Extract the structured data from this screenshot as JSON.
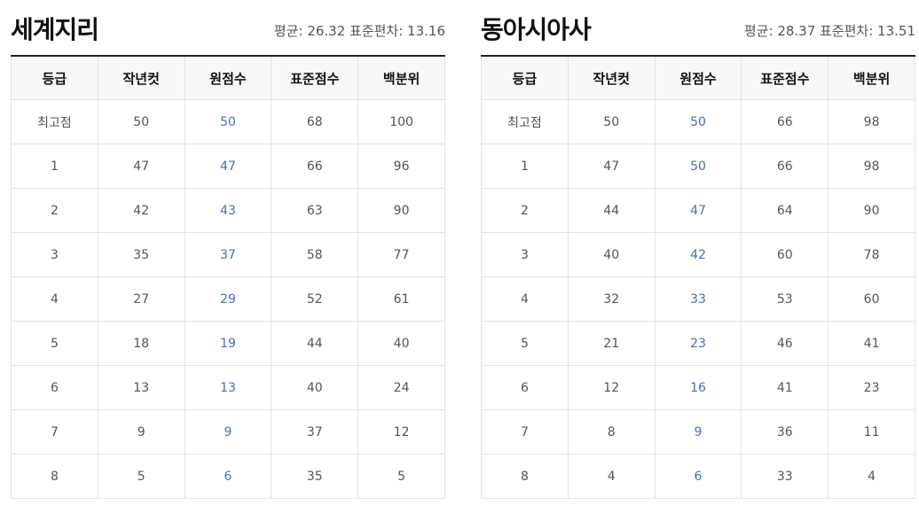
{
  "headers": [
    "등급",
    "작년컷",
    "원점수",
    "표준점수",
    "백분위"
  ],
  "tables": [
    {
      "title": "세계지리",
      "stats": "평균: 26.32 표준편차: 13.16",
      "rows": [
        [
          "최고점",
          "50",
          "50",
          "68",
          "100"
        ],
        [
          "1",
          "47",
          "47",
          "66",
          "96"
        ],
        [
          "2",
          "42",
          "43",
          "63",
          "90"
        ],
        [
          "3",
          "35",
          "37",
          "58",
          "77"
        ],
        [
          "4",
          "27",
          "29",
          "52",
          "61"
        ],
        [
          "5",
          "18",
          "19",
          "44",
          "40"
        ],
        [
          "6",
          "13",
          "13",
          "40",
          "24"
        ],
        [
          "7",
          "9",
          "9",
          "37",
          "12"
        ],
        [
          "8",
          "5",
          "6",
          "35",
          "5"
        ]
      ]
    },
    {
      "title": "동아시아사",
      "stats": "평균: 28.37 표준편차: 13.51",
      "rows": [
        [
          "최고점",
          "50",
          "50",
          "66",
          "98"
        ],
        [
          "1",
          "47",
          "50",
          "66",
          "98"
        ],
        [
          "2",
          "44",
          "47",
          "64",
          "90"
        ],
        [
          "3",
          "40",
          "42",
          "60",
          "78"
        ],
        [
          "4",
          "32",
          "33",
          "53",
          "60"
        ],
        [
          "5",
          "21",
          "23",
          "46",
          "41"
        ],
        [
          "6",
          "12",
          "16",
          "41",
          "23"
        ],
        [
          "7",
          "8",
          "9",
          "36",
          "11"
        ],
        [
          "8",
          "4",
          "6",
          "33",
          "4"
        ]
      ]
    }
  ],
  "colors": {
    "raw_score": "#4a6fb5",
    "header_bg": "#f8f8f8",
    "top_rule": "#222222"
  }
}
